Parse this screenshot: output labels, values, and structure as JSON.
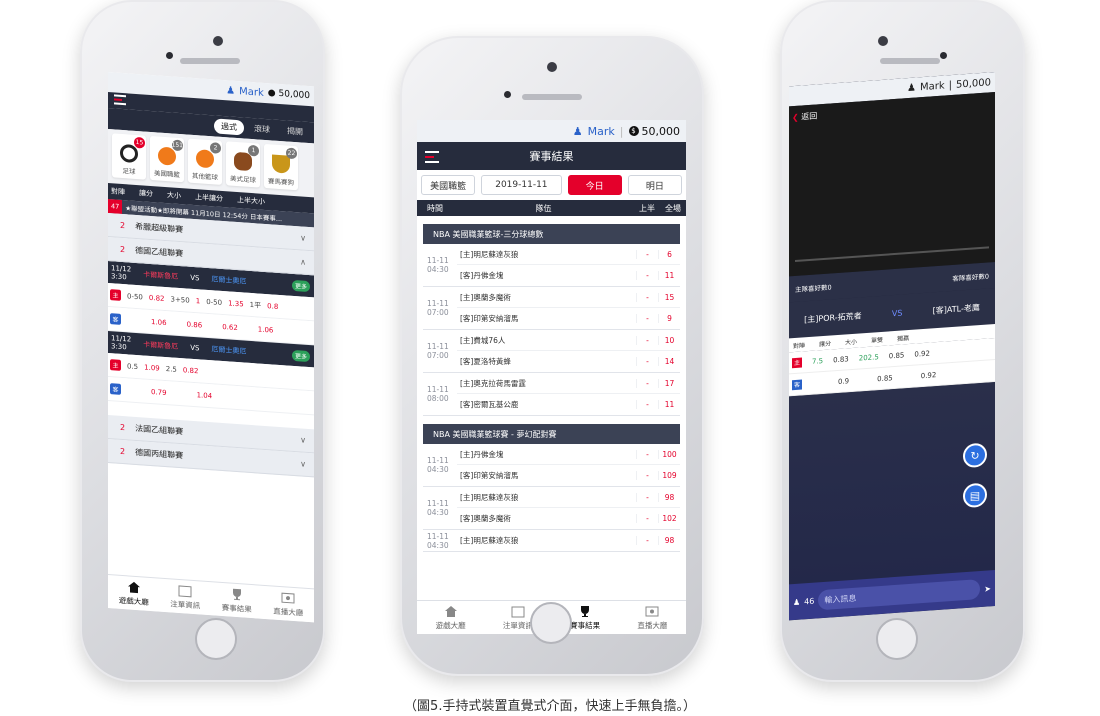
{
  "user": {
    "name": "Mark",
    "balance": "50,000"
  },
  "caption": "（圖5.手持式裝置直覺式介面，快速上手無負擔。）",
  "center": {
    "title": "賽事結果",
    "filters": [
      "美國職籃",
      "2019-11-11",
      "今日",
      "明日"
    ],
    "columns": [
      "時間",
      "隊伍",
      "上半",
      "全場"
    ],
    "leagues": [
      {
        "name": "NBA 美國職業籃球-三分球總數",
        "games": [
          {
            "date": "11-11",
            "time": "04:30",
            "home": "[主]明尼蘇達灰狼",
            "away": "[客]丹佛金塊",
            "home_score": "6",
            "away_score": "11"
          },
          {
            "date": "11-11",
            "time": "07:00",
            "home": "[主]奧蘭多魔術",
            "away": "[客]印第安納溜馬",
            "home_score": "15",
            "away_score": "9"
          },
          {
            "date": "11-11",
            "time": "07:00",
            "home": "[主]費城76人",
            "away": "[客]夏洛特黃蜂",
            "home_score": "10",
            "away_score": "14"
          },
          {
            "date": "11-11",
            "time": "08:00",
            "home": "[主]奧克拉荷馬雷霆",
            "away": "[客]密爾瓦基公鹿",
            "home_score": "17",
            "away_score": "11"
          }
        ]
      },
      {
        "name": "NBA 美國職業籃球賽 - 夢幻配對賽",
        "games": [
          {
            "date": "11-11",
            "time": "04:30",
            "home": "[主]丹佛金塊",
            "away": "[客]印第安納溜馬",
            "home_score": "100",
            "away_score": "109"
          },
          {
            "date": "11-11",
            "time": "04:30",
            "home": "[主]明尼蘇達灰狼",
            "away": "[客]奧蘭多魔術",
            "home_score": "98",
            "away_score": "102"
          },
          {
            "date": "11-11",
            "time": "04:30",
            "home": "[主]明尼蘇達灰狼",
            "away": "",
            "home_score": "98",
            "away_score": ""
          }
        ]
      }
    ],
    "tabs": [
      "遊戲大廳",
      "注單資訊",
      "賽事結果",
      "直播大廳"
    ],
    "active_tab": 2
  },
  "left": {
    "tabs": [
      "過式",
      "滾球",
      "揭開"
    ],
    "sports": [
      {
        "label": "足球",
        "count": "15",
        "color": "#222222"
      },
      {
        "label": "美國職籃",
        "count": "151",
        "color": "#f07a1a"
      },
      {
        "label": "其他籃球",
        "count": "2",
        "color": "#f07a1a"
      },
      {
        "label": "美式足球",
        "count": "1",
        "color": "#8a4a1e"
      },
      {
        "label": "賽馬賽狗",
        "count": "22",
        "color": "#c9961a"
      }
    ],
    "head": [
      "對陣",
      "讓分",
      "大小",
      "上半讓分",
      "上半大小"
    ],
    "ticker_count": "47",
    "ticker": "★聯盟活動★即將開幕 11月10日 12:54分 日本賽事...",
    "leagues": [
      {
        "count": "2",
        "name": "希臘超級聯賽"
      },
      {
        "count": "2",
        "name": "德國乙組聯賽"
      }
    ],
    "matches": [
      {
        "date": "11/12",
        "time": "3:30",
        "home": "卡爾斯魯厄",
        "vs": "VS",
        "away": "厄爾士奧厄",
        "more": "更多",
        "home_row": [
          "主",
          "0-50",
          "0.82",
          "3+50",
          "1",
          "0-50",
          "1.35",
          "1平",
          "0.8"
        ],
        "away_row": [
          "客",
          "1.06",
          "0.86",
          "0.62",
          "1.06"
        ]
      },
      {
        "date": "11/12",
        "time": "3:30",
        "home": "卡爾斯魯厄",
        "vs": "VS",
        "away": "厄爾士奧厄",
        "more": "更多",
        "home_row": [
          "主",
          "0.5",
          "1.09",
          "2.5",
          "0.82"
        ],
        "away_row": [
          "客",
          "0.79",
          "1.04"
        ]
      }
    ],
    "more_leagues": [
      {
        "count": "2",
        "name": "法國乙組聯賽"
      },
      {
        "count": "2",
        "name": "德國丙組聯賽"
      }
    ],
    "bottom_tabs": [
      "遊戲大廳",
      "注單資訊",
      "賽事結果",
      "直播大廳"
    ]
  },
  "right": {
    "back": "返回",
    "home_likes": "主隊喜好數0",
    "away_likes": "客隊喜好數0",
    "home_team": "[主]POR-拓荒者",
    "vs": "VS",
    "away_team": "[客]ATL-老鷹",
    "odds_head": [
      "對陣",
      "讓分",
      "大小",
      "單雙",
      "獨贏"
    ],
    "home_odds": [
      "主",
      "7.5",
      "0.83",
      "202.5",
      "0.85",
      "0.92"
    ],
    "away_odds": [
      "客",
      "0.9",
      "0.85",
      "0.92"
    ],
    "viewers": "46",
    "input_placeholder": "輸入訊息"
  },
  "colors": {
    "accent": "#e4002b",
    "navy": "#262c3d",
    "blue": "#2a62c9"
  }
}
